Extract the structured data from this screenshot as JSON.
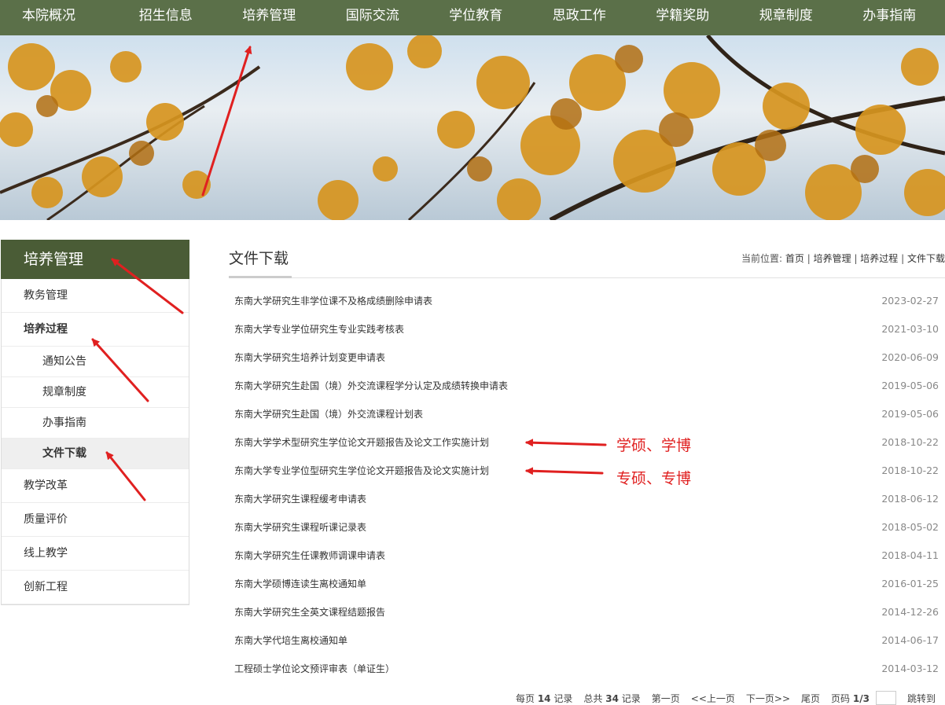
{
  "topnav": {
    "items": [
      "本院概况",
      "招生信息",
      "培养管理",
      "国际交流",
      "学位教育",
      "思政工作",
      "学籍奖助",
      "规章制度",
      "办事指南"
    ]
  },
  "sidebar": {
    "title": "培养管理",
    "items": [
      {
        "label": "教务管理",
        "level": 1
      },
      {
        "label": "培养过程",
        "level": 1,
        "bold": true
      },
      {
        "label": "通知公告",
        "level": 2
      },
      {
        "label": "规章制度",
        "level": 2
      },
      {
        "label": "办事指南",
        "level": 2
      },
      {
        "label": "文件下载",
        "level": 2,
        "active": true
      },
      {
        "label": "教学改革",
        "level": 1
      },
      {
        "label": "质量评价",
        "level": 1
      },
      {
        "label": "线上教学",
        "level": 1
      },
      {
        "label": "创新工程",
        "level": 1
      }
    ]
  },
  "content": {
    "title": "文件下载",
    "breadcrumb": {
      "prefix": "当前位置:",
      "items": [
        "首页",
        "培养管理",
        "培养过程",
        "文件下载"
      ]
    },
    "files": [
      {
        "name": "东南大学研究生非学位课不及格成绩删除申请表",
        "date": "2023-02-27"
      },
      {
        "name": "东南大学专业学位研究生专业实践考核表",
        "date": "2021-03-10"
      },
      {
        "name": "东南大学研究生培养计划变更申请表",
        "date": "2020-06-09"
      },
      {
        "name": "东南大学研究生赴国（境）外交流课程学分认定及成绩转换申请表",
        "date": "2019-05-06"
      },
      {
        "name": "东南大学研究生赴国（境）外交流课程计划表",
        "date": "2019-05-06"
      },
      {
        "name": "东南大学学术型研究生学位论文开题报告及论文工作实施计划",
        "date": "2018-10-22"
      },
      {
        "name": "东南大学专业学位型研究生学位论文开题报告及论文实施计划",
        "date": "2018-10-22"
      },
      {
        "name": "东南大学研究生课程缓考申请表",
        "date": "2018-06-12"
      },
      {
        "name": "东南大学研究生课程听课记录表",
        "date": "2018-05-02"
      },
      {
        "name": "东南大学研究生任课教师调课申请表",
        "date": "2018-04-11"
      },
      {
        "name": "东南大学硕博连读生离校通知单",
        "date": "2016-01-25"
      },
      {
        "name": "东南大学研究生全英文课程结题报告",
        "date": "2014-12-26"
      },
      {
        "name": "东南大学代培生离校通知单",
        "date": "2014-06-17"
      },
      {
        "name": "工程硕士学位论文预评审表（单证生）",
        "date": "2014-03-12"
      }
    ],
    "pager": {
      "per_page_prefix": "每页",
      "per_page": "14",
      "per_page_suffix": "记录",
      "total_prefix": "总共",
      "total": "34",
      "total_suffix": "记录",
      "first": "第一页",
      "prev": "<<上一页",
      "next": "下一页>>",
      "last": "尾页",
      "page_prefix": "页码",
      "page": "1/3",
      "jump": "跳转到"
    }
  },
  "annotations": {
    "label_1": "学硕、学博",
    "label_2": "专硕、专博",
    "color": "#e02020"
  }
}
